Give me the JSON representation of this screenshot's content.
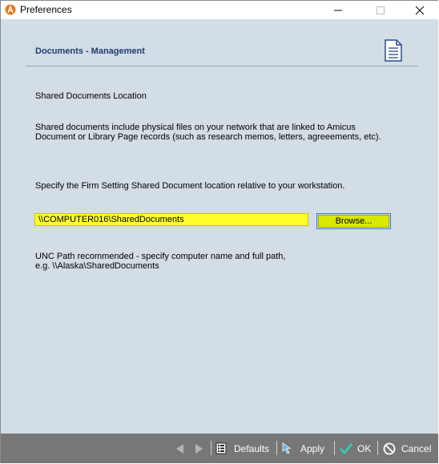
{
  "window": {
    "title": "Preferences"
  },
  "section": {
    "title": "Documents - Management"
  },
  "content": {
    "heading": "Shared Documents Location",
    "description_line1": "Shared documents include physical files on your network that are linked to Amicus",
    "description_line2": "Document or Library Page records (such as research memos, letters, agreeements, etc).",
    "instruction": "Specify the Firm Setting Shared Document location relative to your workstation.",
    "path_value": "\\\\COMPUTER016\\SharedDocuments",
    "browse_label": "Browse...",
    "note_line1": "UNC Path recommended - specify computer name and full path,",
    "note_line2": "e.g. \\\\Alaska\\SharedDocuments"
  },
  "footer": {
    "defaults_label": "Defaults",
    "apply_label": "Apply",
    "ok_label": "OK",
    "cancel_label": "Cancel"
  },
  "colors": {
    "content_bg": "#d3dde5",
    "section_title": "#1f3b73",
    "highlight_yellow": "#ffff2e",
    "footer_bg": "#777777",
    "ok_check": "#2ed0b4"
  }
}
